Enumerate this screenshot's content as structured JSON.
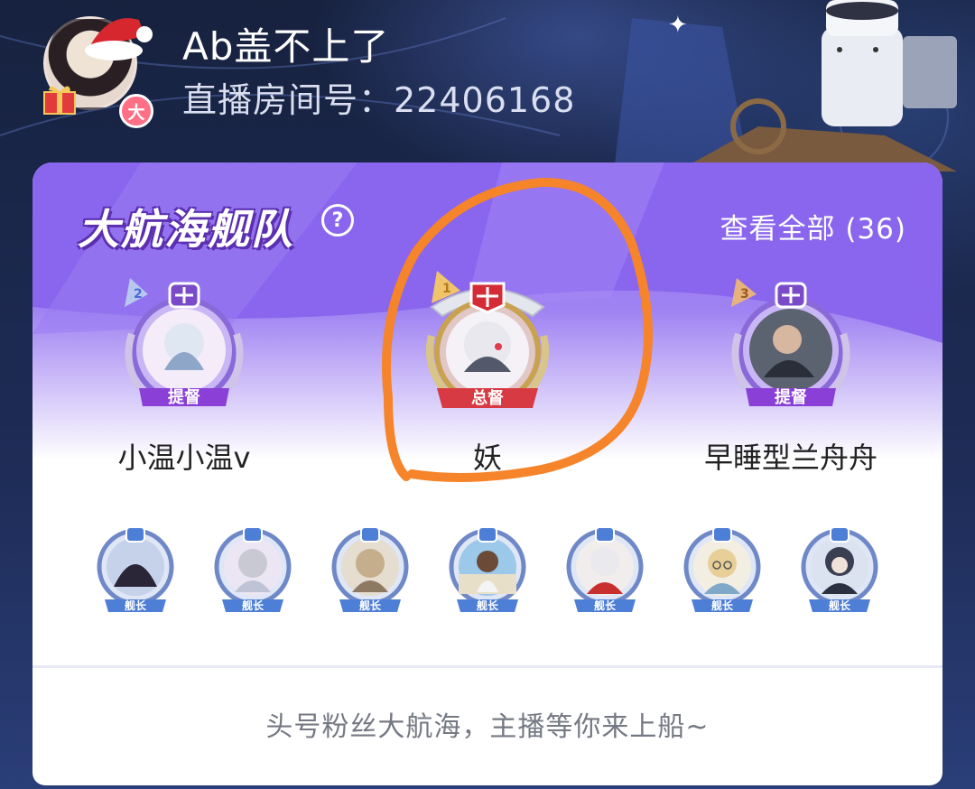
{
  "header": {
    "streamer_name": "Ab盖不上了",
    "room_label": "直播房间号：22406168",
    "level_badge": "大"
  },
  "fleet": {
    "title": "大航海舰队",
    "help_icon": "?",
    "view_all": "查看全部 (36)",
    "top_members": [
      {
        "name": "小温小温v",
        "rank": "提督",
        "badge_number": "2"
      },
      {
        "name": "妖",
        "rank": "总督",
        "badge_number": "1"
      },
      {
        "name": "早睡型兰舟舟",
        "rank": "提督",
        "badge_number": "3"
      }
    ],
    "captain_label": "舰长",
    "captains": [
      {
        "avatar": "dark-creature-avatar"
      },
      {
        "avatar": "silver-hair-girl-avatar"
      },
      {
        "avatar": "blonde-girl-avatar"
      },
      {
        "avatar": "beach-girl-avatar"
      },
      {
        "avatar": "white-hair-boy-avatar"
      },
      {
        "avatar": "blonde-glasses-boy-avatar"
      },
      {
        "avatar": "dark-hair-boy-avatar"
      }
    ],
    "footer": "头号粉丝大航海，主播等你来上船~"
  },
  "colors": {
    "header_bg": "#1e2c57",
    "card_purple": "#8e6cf0",
    "admiral_ribbon": "#8a3fd6",
    "governor_ribbon": "#d83a43",
    "captain_ribbon": "#4e7fd6",
    "annotation_stroke": "#f5842a"
  }
}
